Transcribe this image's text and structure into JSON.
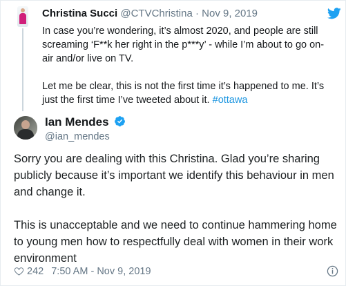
{
  "parent_tweet": {
    "author_name": "Christina Succi",
    "author_handle": "@CTVChristina",
    "separator": " · ",
    "date": "Nov 9, 2019",
    "paragraphs": [
      "In case you’re wondering, it’s almost 2020, and people are still screaming ‘F**k her right in the p***y’ - while I’m about to go on-air and/or live on TV.",
      "Let me be clear, this is not the first time it’s happened to me. It’s just the first time I’ve tweeted about it."
    ],
    "hashtag": "#ottawa"
  },
  "tweet": {
    "author_name": "Ian Mendes",
    "author_handle": "@ian_mendes",
    "paragraphs": [
      "Sorry you are dealing with this Christina. Glad you’re sharing publicly because it’s important we identify this behaviour in men and change it.",
      "This is unacceptable and we need to continue hammering home to young men how to respectfully deal with women in their work environment"
    ],
    "likes": "242",
    "timestamp": "7:50 AM - Nov 9, 2019"
  },
  "icons": {
    "brand": "twitter-bird-icon",
    "verified": "verified-badge-icon",
    "like": "heart-icon",
    "info": "info-icon"
  },
  "colors": {
    "link": "#1b95e0",
    "verified": "#1da1f2",
    "muted": "#657786",
    "like": "#e0245e"
  }
}
